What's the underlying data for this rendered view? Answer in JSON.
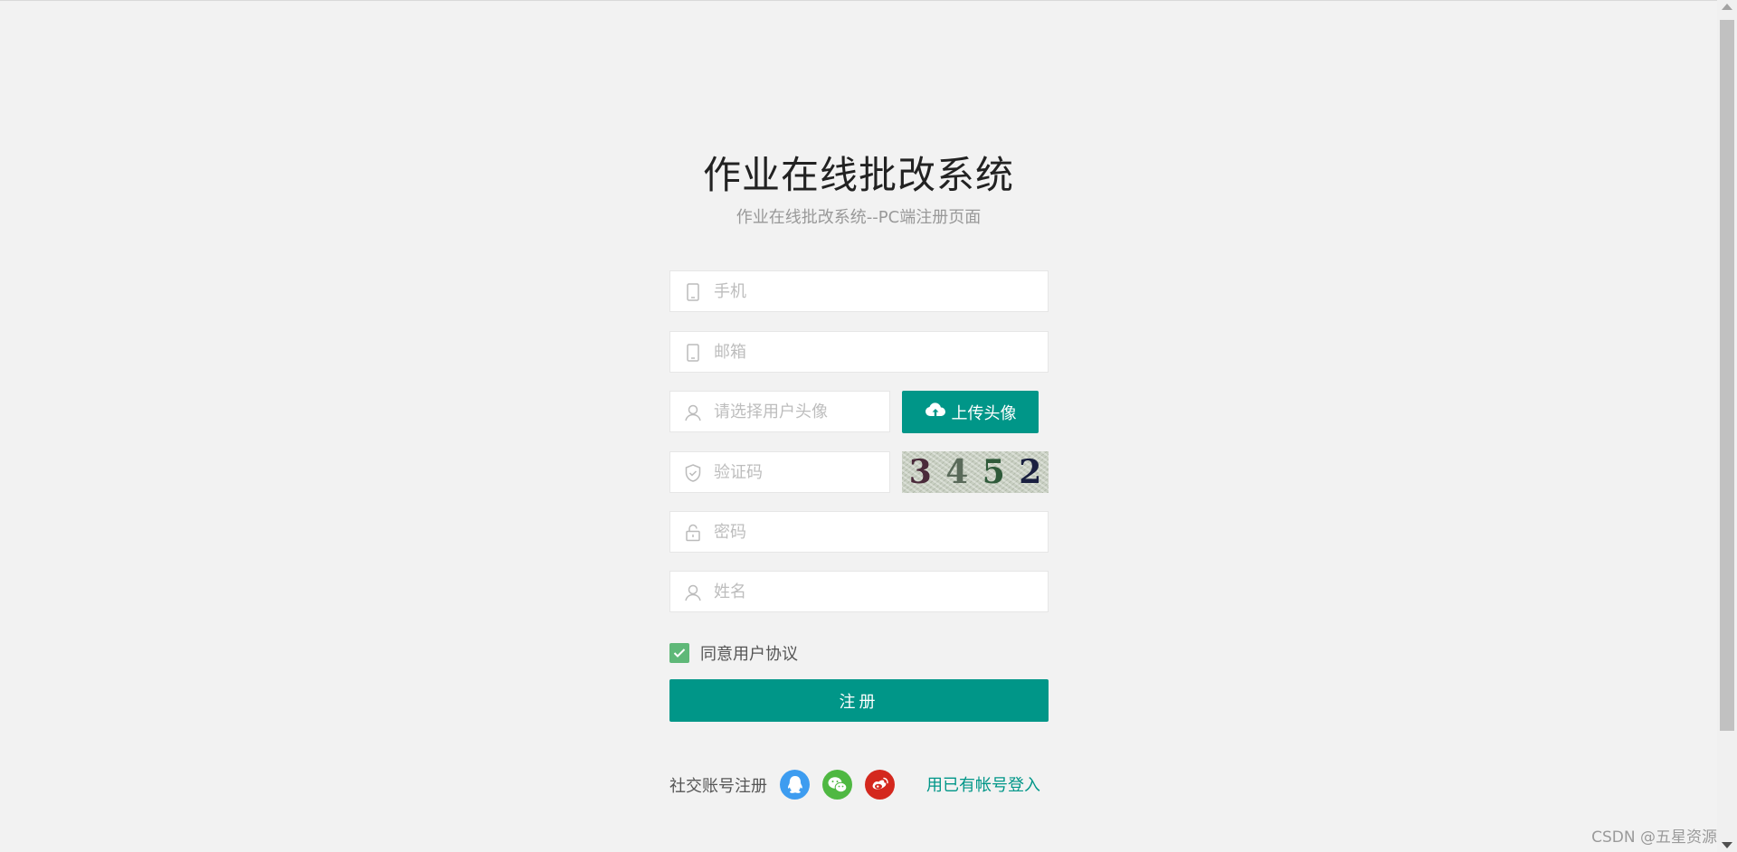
{
  "header": {
    "title": "作业在线批改系统",
    "subtitle": "作业在线批改系统--PC端注册页面"
  },
  "form": {
    "phone": {
      "placeholder": "手机",
      "value": "",
      "icon": "mobile-icon"
    },
    "email": {
      "placeholder": "邮箱",
      "value": "",
      "icon": "mobile-icon"
    },
    "avatar": {
      "placeholder": "请选择用户头像",
      "value": "",
      "icon": "user-icon"
    },
    "upload_label": "上传头像",
    "captcha_input": {
      "placeholder": "验证码",
      "value": "",
      "icon": "shield-icon"
    },
    "captcha_digits": [
      "3",
      "4",
      "5",
      "2"
    ],
    "password": {
      "placeholder": "密码",
      "value": "",
      "icon": "lock-icon"
    },
    "name": {
      "placeholder": "姓名",
      "value": "",
      "icon": "user-icon"
    },
    "agree_label": "同意用户协议",
    "agree_checked": true,
    "register_label": "注册"
  },
  "social": {
    "label": "社交账号注册",
    "icons": [
      "qq-icon",
      "wechat-icon",
      "weibo-icon"
    ],
    "colors": {
      "qq": "#3d9cf0",
      "wechat": "#4fb842",
      "weibo": "#d4281e"
    },
    "login_link": "用已有帐号登入"
  },
  "theme": {
    "accent": "#009688",
    "checkbox": "#5fb878",
    "background": "#f2f2f2"
  },
  "watermark": "CSDN @五星资源"
}
